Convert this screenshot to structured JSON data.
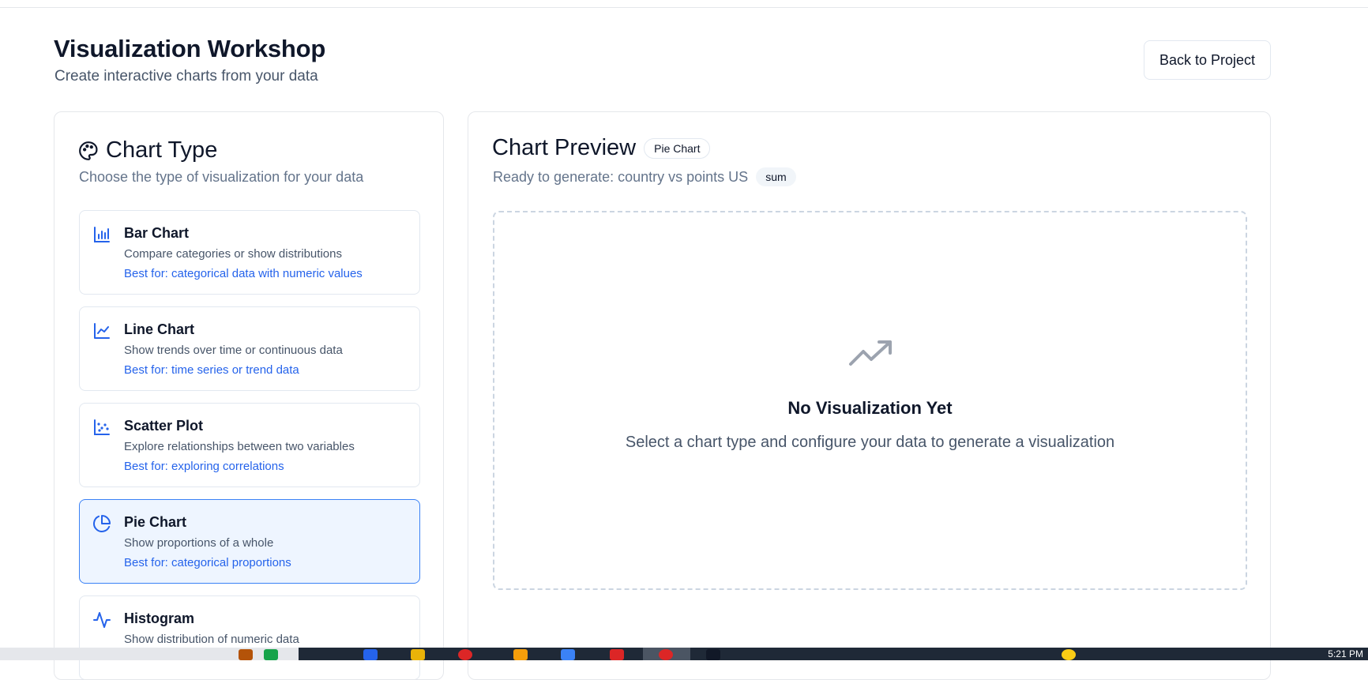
{
  "header": {
    "title": "Visualization Workshop",
    "subtitle": "Create interactive charts from your data",
    "back_button": "Back to Project"
  },
  "chart_type_panel": {
    "title": "Chart Type",
    "subtitle": "Choose the type of visualization for your data",
    "types": [
      {
        "name": "Bar Chart",
        "description": "Compare categories or show distributions",
        "best_for": "Best for: categorical data with numeric values",
        "icon": "bar-chart-icon",
        "selected": false
      },
      {
        "name": "Line Chart",
        "description": "Show trends over time or continuous data",
        "best_for": "Best for: time series or trend data",
        "icon": "line-chart-icon",
        "selected": false
      },
      {
        "name": "Scatter Plot",
        "description": "Explore relationships between two variables",
        "best_for": "Best for: exploring correlations",
        "icon": "scatter-plot-icon",
        "selected": false
      },
      {
        "name": "Pie Chart",
        "description": "Show proportions of a whole",
        "best_for": "Best for: categorical proportions",
        "icon": "pie-chart-icon",
        "selected": true
      },
      {
        "name": "Histogram",
        "description": "Show distribution of numeric data",
        "best_for": "",
        "icon": "activity-icon",
        "selected": false
      }
    ]
  },
  "chart_preview": {
    "title": "Chart Preview",
    "type_badge": "Pie Chart",
    "status_text": "Ready to generate: country vs points US",
    "aggregation_badge": "sum",
    "empty_title": "No Visualization Yet",
    "empty_text": "Select a chart type and configure your data to generate a visualization"
  },
  "taskbar": {
    "clock": "5:21 PM"
  },
  "colors": {
    "accent": "#2563eb",
    "selected_bg": "#eef5ff",
    "border": "#e2e8f0"
  }
}
